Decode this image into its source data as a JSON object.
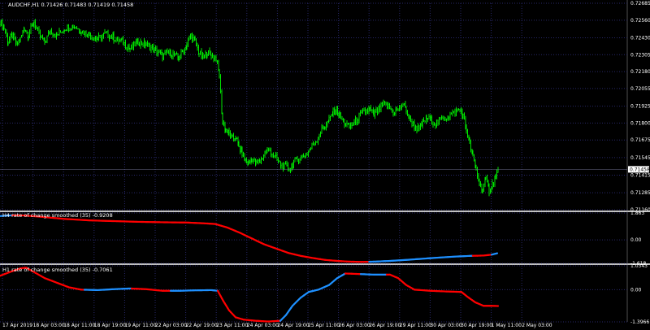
{
  "header": {
    "main_title": "AUDCHF,H1  0.71426 0.71483 0.71419 0.71458",
    "pane1_title": "H4 rate of change smoothed (35) -0.9208",
    "pane2_title": "H1 rate of change smoothed (35) -0.7061"
  },
  "colors": {
    "background": "#000000",
    "grid": "#28286a",
    "candles": "#00ff00",
    "separator": "#ffffff",
    "ind_down": "#ff0000",
    "ind_up": "#1e90ff",
    "price_tag_bg": "#ffffff",
    "price_tag_text": "#000000"
  },
  "chart_data": [
    {
      "type": "candlestick",
      "symbol": "AUDCHF,H1",
      "ylim": [
        0.7116,
        0.72685
      ],
      "y_ticks": [
        "0.72685",
        "0.72560",
        "0.72430",
        "0.72305",
        "0.72180",
        "0.72055",
        "0.71925",
        "0.71800",
        "0.71675",
        "0.71545",
        "0.71415",
        "0.71285",
        "0.71160"
      ],
      "current_price": "0.71458",
      "x_ticks": [
        "17 Apr 2019",
        "18 Apr 03:00",
        "18 Apr 11:00",
        "18 Apr 19:00",
        "19 Apr 11:00",
        "22 Apr 03:00",
        "22 Apr 19:00",
        "23 Apr 11:00",
        "24 Apr 03:00",
        "24 Apr 19:00",
        "25 Apr 11:00",
        "26 Apr 03:00",
        "26 Apr 19:00",
        "29 Apr 11:00",
        "30 Apr 03:00",
        "30 Apr 19:00",
        "1 May 11:00",
        "2 May 03:00"
      ],
      "path": [
        [
          0,
          0.7255
        ],
        [
          5,
          0.725
        ],
        [
          10,
          0.724
        ],
        [
          15,
          0.7245
        ],
        [
          20,
          0.7238
        ],
        [
          25,
          0.7242
        ],
        [
          30,
          0.725
        ],
        [
          35,
          0.7245
        ],
        [
          42,
          0.7255
        ],
        [
          48,
          0.7245
        ],
        [
          55,
          0.724
        ],
        [
          62,
          0.7248
        ],
        [
          70,
          0.7245
        ],
        [
          80,
          0.725
        ],
        [
          90,
          0.7252
        ],
        [
          100,
          0.7248
        ],
        [
          110,
          0.7245
        ],
        [
          120,
          0.7242
        ],
        [
          130,
          0.7246
        ],
        [
          140,
          0.7243
        ],
        [
          150,
          0.724
        ],
        [
          160,
          0.7235
        ],
        [
          170,
          0.724
        ],
        [
          180,
          0.7238
        ],
        [
          190,
          0.7234
        ],
        [
          200,
          0.723
        ],
        [
          210,
          0.7232
        ],
        [
          220,
          0.7228
        ],
        [
          230,
          0.7238
        ],
        [
          235,
          0.7245
        ],
        [
          240,
          0.724
        ],
        [
          245,
          0.7232
        ],
        [
          250,
          0.7228
        ],
        [
          255,
          0.7232
        ],
        [
          260,
          0.723
        ],
        [
          266,
          0.7228
        ],
        [
          270,
          0.7215
        ],
        [
          274,
          0.718
        ],
        [
          278,
          0.7175
        ],
        [
          282,
          0.7172
        ],
        [
          286,
          0.7168
        ],
        [
          290,
          0.717
        ],
        [
          294,
          0.7162
        ],
        [
          298,
          0.7158
        ],
        [
          302,
          0.7152
        ],
        [
          306,
          0.715
        ],
        [
          310,
          0.7154
        ],
        [
          315,
          0.715
        ],
        [
          320,
          0.7152
        ],
        [
          326,
          0.7158
        ],
        [
          332,
          0.716
        ],
        [
          338,
          0.7155
        ],
        [
          344,
          0.715
        ],
        [
          350,
          0.7148
        ],
        [
          356,
          0.7146
        ],
        [
          360,
          0.715
        ],
        [
          366,
          0.7153
        ],
        [
          372,
          0.7155
        ],
        [
          378,
          0.7158
        ],
        [
          384,
          0.7163
        ],
        [
          390,
          0.7168
        ],
        [
          396,
          0.7175
        ],
        [
          400,
          0.7178
        ],
        [
          405,
          0.7182
        ],
        [
          410,
          0.7188
        ],
        [
          414,
          0.719
        ],
        [
          418,
          0.7185
        ],
        [
          424,
          0.718
        ],
        [
          430,
          0.7177
        ],
        [
          436,
          0.718
        ],
        [
          442,
          0.7185
        ],
        [
          448,
          0.7188
        ],
        [
          455,
          0.719
        ],
        [
          460,
          0.7186
        ],
        [
          466,
          0.719
        ],
        [
          472,
          0.7194
        ],
        [
          478,
          0.7192
        ],
        [
          484,
          0.7188
        ],
        [
          490,
          0.719
        ],
        [
          496,
          0.7194
        ],
        [
          500,
          0.719
        ],
        [
          504,
          0.7182
        ],
        [
          510,
          0.7178
        ],
        [
          516,
          0.7175
        ],
        [
          520,
          0.718
        ],
        [
          525,
          0.7184
        ],
        [
          530,
          0.7182
        ],
        [
          536,
          0.718
        ],
        [
          542,
          0.7182
        ],
        [
          548,
          0.7184
        ],
        [
          554,
          0.7186
        ],
        [
          560,
          0.7188
        ],
        [
          566,
          0.719
        ],
        [
          570,
          0.7185
        ],
        [
          574,
          0.7175
        ],
        [
          578,
          0.7165
        ],
        [
          582,
          0.7155
        ],
        [
          586,
          0.7145
        ],
        [
          590,
          0.7135
        ],
        [
          594,
          0.7132
        ],
        [
          598,
          0.7138
        ],
        [
          602,
          0.713
        ],
        [
          606,
          0.7135
        ],
        [
          610,
          0.714
        ],
        [
          614,
          0.7146
        ]
      ]
    },
    {
      "type": "line",
      "name": "H4 rate of change smoothed (35) -0.9208",
      "ylim": [
        -1.618,
        1.863
      ],
      "y_ticks": [
        "1.863",
        "0.00",
        "-1.618"
      ],
      "points": [
        [
          0,
          1.65
        ],
        [
          15,
          1.7
        ],
        [
          30,
          1.69
        ],
        [
          50,
          1.6
        ],
        [
          80,
          1.45
        ],
        [
          110,
          1.35
        ],
        [
          140,
          1.3
        ],
        [
          170,
          1.25
        ],
        [
          200,
          1.22
        ],
        [
          230,
          1.2
        ],
        [
          250,
          1.15
        ],
        [
          265,
          1.1
        ],
        [
          280,
          0.85
        ],
        [
          295,
          0.5
        ],
        [
          310,
          0.1
        ],
        [
          325,
          -0.3
        ],
        [
          340,
          -0.6
        ],
        [
          355,
          -0.9
        ],
        [
          370,
          -1.1
        ],
        [
          385,
          -1.25
        ],
        [
          400,
          -1.38
        ],
        [
          415,
          -1.45
        ],
        [
          430,
          -1.5
        ],
        [
          445,
          -1.52
        ],
        [
          460,
          -1.5
        ],
        [
          480,
          -1.45
        ],
        [
          500,
          -1.38
        ],
        [
          520,
          -1.3
        ],
        [
          540,
          -1.22
        ],
        [
          560,
          -1.15
        ],
        [
          580,
          -1.1
        ],
        [
          595,
          -1.08
        ],
        [
          605,
          -1.02
        ],
        [
          612,
          -0.92
        ]
      ],
      "up_color_ranges": [
        [
          0,
          15
        ],
        [
          455,
          582
        ],
        [
          605,
          612
        ]
      ]
    },
    {
      "type": "line",
      "name": "H1 rate of change smoothed (35) -0.7061",
      "ylim": [
        -1.3966,
        1.0343
      ],
      "y_ticks": [
        "1.0343",
        "0.00",
        "-1.3966"
      ],
      "points": [
        [
          0,
          0.6
        ],
        [
          15,
          0.8
        ],
        [
          25,
          0.92
        ],
        [
          32,
          0.95
        ],
        [
          40,
          0.8
        ],
        [
          55,
          0.5
        ],
        [
          70,
          0.3
        ],
        [
          85,
          0.1
        ],
        [
          100,
          0.0
        ],
        [
          120,
          -0.02
        ],
        [
          140,
          0.02
        ],
        [
          160,
          0.05
        ],
        [
          180,
          0.02
        ],
        [
          200,
          -0.05
        ],
        [
          220,
          -0.05
        ],
        [
          240,
          -0.03
        ],
        [
          260,
          -0.02
        ],
        [
          268,
          -0.05
        ],
        [
          275,
          -0.5
        ],
        [
          282,
          -0.9
        ],
        [
          290,
          -1.2
        ],
        [
          300,
          -1.3
        ],
        [
          315,
          -1.35
        ],
        [
          330,
          -1.38
        ],
        [
          345,
          -1.35
        ],
        [
          352,
          -1.1
        ],
        [
          360,
          -0.7
        ],
        [
          370,
          -0.35
        ],
        [
          380,
          -0.1
        ],
        [
          392,
          0.0
        ],
        [
          405,
          0.2
        ],
        [
          415,
          0.5
        ],
        [
          425,
          0.7
        ],
        [
          440,
          0.68
        ],
        [
          460,
          0.65
        ],
        [
          480,
          0.65
        ],
        [
          490,
          0.5
        ],
        [
          500,
          0.2
        ],
        [
          510,
          0.0
        ],
        [
          530,
          -0.05
        ],
        [
          550,
          -0.08
        ],
        [
          568,
          -0.1
        ],
        [
          575,
          -0.3
        ],
        [
          585,
          -0.55
        ],
        [
          595,
          -0.7
        ],
        [
          605,
          -0.7
        ],
        [
          613,
          -0.71
        ]
      ],
      "up_color_ranges": [
        [
          105,
          162
        ],
        [
          210,
          268
        ],
        [
          345,
          425
        ],
        [
          445,
          476
        ]
      ]
    }
  ]
}
